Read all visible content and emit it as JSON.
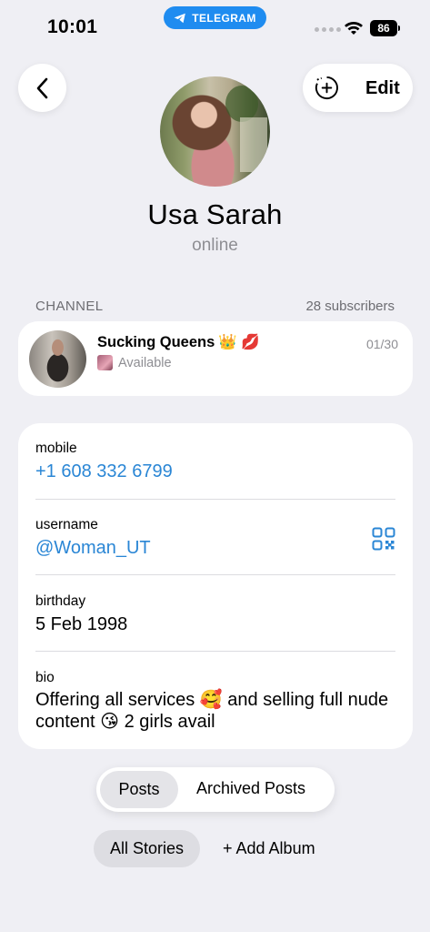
{
  "status_bar": {
    "time": "10:01",
    "app_pill": "TELEGRAM",
    "battery": "86"
  },
  "header": {
    "edit_label": "Edit"
  },
  "profile": {
    "name": "Usa Sarah",
    "status": "online"
  },
  "channel": {
    "section_label": "CHANNEL",
    "subscribers": "28 subscribers",
    "title": "Sucking Queens",
    "title_emoji": "👑 💋",
    "date": "01/30",
    "subtitle": "Available"
  },
  "info": {
    "mobile_label": "mobile",
    "mobile_value": "+1 608 332 6799",
    "username_label": "username",
    "username_value": "@Woman_UT",
    "birthday_label": "birthday",
    "birthday_value": "5 Feb 1998",
    "bio_label": "bio",
    "bio_value": "Offering all services 🥰 and selling full nude content 😘 2 girls avail"
  },
  "tabs": {
    "posts": "Posts",
    "archived": "Archived Posts"
  },
  "stories": {
    "all": "All Stories",
    "add_album": "+ Add Album"
  },
  "colors": {
    "accent": "#2a86d5",
    "telegram_pill": "#1f8cf0",
    "background": "#efeff4"
  },
  "icons": [
    "back-chevron-icon",
    "add-story-icon",
    "wifi-icon",
    "telegram-plane-icon",
    "qr-code-icon"
  ]
}
